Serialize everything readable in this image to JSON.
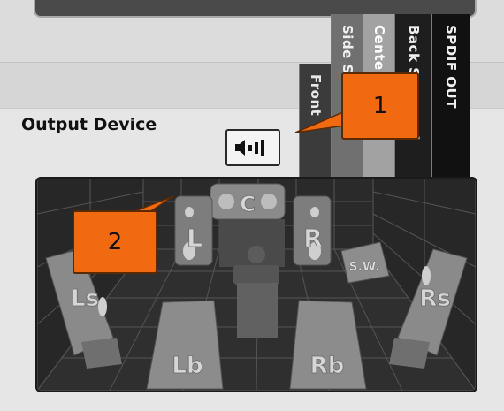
{
  "output_device": {
    "title": "Output Device",
    "tabs": [
      {
        "label": "Front"
      },
      {
        "label": "Side Surround"
      },
      {
        "label": "Center/Sub"
      },
      {
        "label": "Back Surround"
      },
      {
        "label": "SPDIF OUT"
      }
    ],
    "speaker_button_icon": "speaker-bars-icon",
    "callouts": [
      {
        "label": "1"
      },
      {
        "label": "2"
      }
    ],
    "room": {
      "speakers": [
        {
          "label": "C"
        },
        {
          "label": "L"
        },
        {
          "label": "R"
        },
        {
          "label": "S.W."
        },
        {
          "label": "Ls"
        },
        {
          "label": "Rs"
        },
        {
          "label": "Lb"
        },
        {
          "label": "Rb"
        }
      ]
    }
  },
  "colors": {
    "callout_orange": "#f26a0f",
    "room_bg": "#2b2b2b",
    "panel_bg": "#e6e6e6"
  }
}
